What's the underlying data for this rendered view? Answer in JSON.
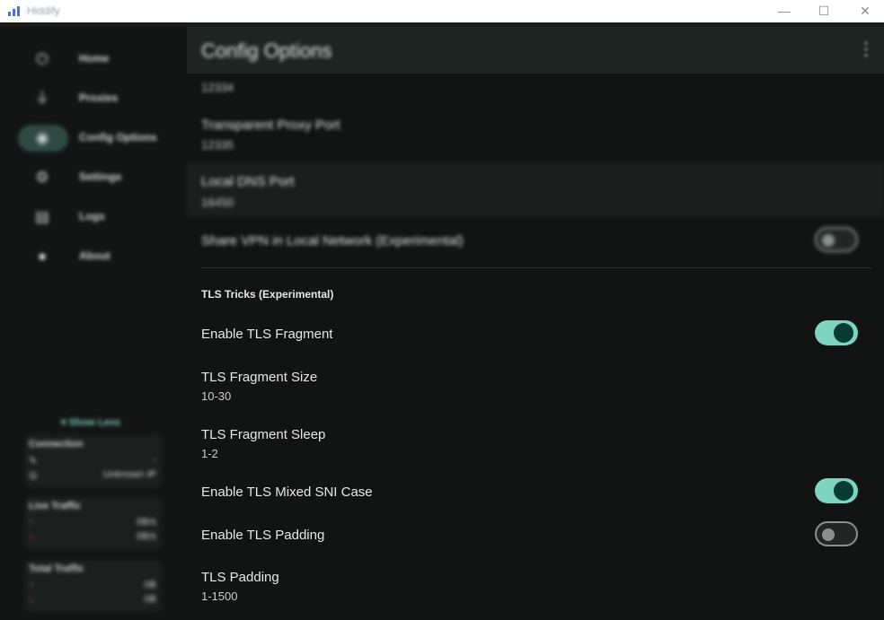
{
  "window": {
    "title": "Hiddify",
    "minimize": "—",
    "maximize": "☐",
    "close": "✕"
  },
  "sidebar": {
    "items": [
      {
        "label": "Home",
        "icon": "power-icon",
        "glyph": "⏻"
      },
      {
        "label": "Proxies",
        "icon": "filter-icon",
        "glyph": "⏚"
      },
      {
        "label": "Config Options",
        "icon": "config-options-icon",
        "glyph": "◉"
      },
      {
        "label": "Settings",
        "icon": "gear-icon",
        "glyph": "⚙"
      },
      {
        "label": "Logs",
        "icon": "document-icon",
        "glyph": "▤"
      },
      {
        "label": "About",
        "icon": "info-icon",
        "glyph": "●"
      }
    ],
    "active_index": 2,
    "show_less": "Show Less",
    "connection": {
      "title": "Connection",
      "ip": "Unknown IP",
      "route": "-"
    },
    "live_traffic": {
      "title": "Live Traffic",
      "up": "0B/s",
      "down": "0B/s"
    },
    "total_traffic": {
      "title": "Total Traffic",
      "up": "0B",
      "down": "0B"
    }
  },
  "header": {
    "title": "Config Options",
    "more": "⋮"
  },
  "options": {
    "partial_port": "12334",
    "transparent_proxy": {
      "label": "Transparent Proxy Port",
      "value": "12335"
    },
    "local_dns": {
      "label": "Local DNS Port",
      "value": "16450"
    },
    "share_vpn": {
      "label": "Share VPN in Local Network (Experimental)",
      "enabled": false
    }
  },
  "tls": {
    "section_title": "TLS Tricks (Experimental)",
    "fragment": {
      "label": "Enable TLS Fragment",
      "enabled": true
    },
    "fragment_size": {
      "label": "TLS Fragment Size",
      "value": "10-30"
    },
    "fragment_sleep": {
      "label": "TLS Fragment Sleep",
      "value": "1-2"
    },
    "mixed_sni": {
      "label": "Enable TLS Mixed SNI Case",
      "enabled": true
    },
    "padding_enable": {
      "label": "Enable TLS Padding",
      "enabled": false
    },
    "padding": {
      "label": "TLS Padding",
      "value": "1-1500"
    }
  },
  "colors": {
    "accent": "#7ed4c0",
    "knob_on": "#053b32",
    "background": "#111413"
  }
}
